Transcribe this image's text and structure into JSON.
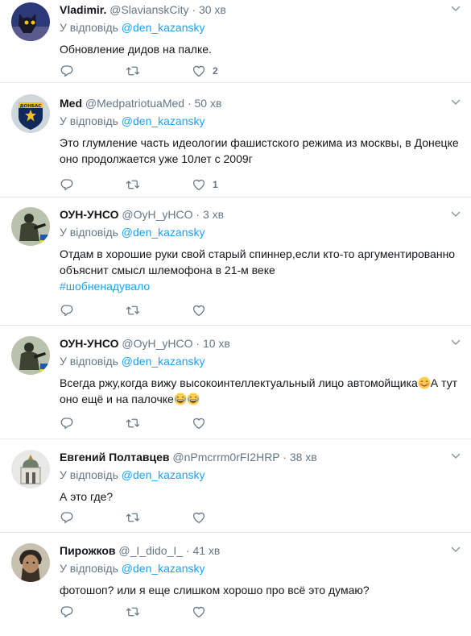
{
  "reply_prefix": "У відповідь",
  "tweets": [
    {
      "name": "Vladimir.",
      "handle": "@SlavianskCity",
      "time": "30 хв",
      "mention": "@den_kazansky",
      "text": "Обновление дидов на палке.",
      "likes": "2"
    },
    {
      "name": "Med",
      "handle": "@MedpatriotuaMed",
      "time": "50 хв",
      "mention": "@den_kazansky",
      "text": "Это глумление часть идеологии фашистского режима из москвы, в Донецке оно продолжается уже 10лет с 2009г",
      "likes": "1",
      "avatar_text": "ДОНБАС"
    },
    {
      "name": "ОУН-УНСО",
      "handle": "@OyH_yHCO",
      "time": "3 хв",
      "mention": "@den_kazansky",
      "text": "Отдам в хорошие руки свой старый спиннер,если кто-то аргументированно объяснит смысл шлемофона в 21-м веке",
      "hashtag": "#шобненадувало"
    },
    {
      "name": "ОУН-УНСО",
      "handle": "@OyH_yHCO",
      "time": "10 хв",
      "mention": "@den_kazansky",
      "text_a": "Всегда ржу,когда вижу высокоинтеллектуальный лицо автомойщика",
      "text_b": "А тут оно ещё и на палочке"
    },
    {
      "name": "Евгений Полтавцев",
      "handle": "@nPmcrrm0rFI2HRP",
      "time": "38 хв",
      "mention": "@den_kazansky",
      "text": "А это где?"
    },
    {
      "name": "Пирожков",
      "handle": "@_I_dido_I_",
      "time": "41 хв",
      "mention": "@den_kazansky",
      "text": "фотошоп? или я еще слишком хорошо про всё это думаю?"
    }
  ],
  "icons": [
    "reply-icon",
    "retweet-icon",
    "like-icon",
    "caret-down-icon"
  ],
  "colors": {
    "link": "#1da1f2",
    "muted": "#657786",
    "text": "#14171a",
    "divider": "#e6ecf0"
  }
}
